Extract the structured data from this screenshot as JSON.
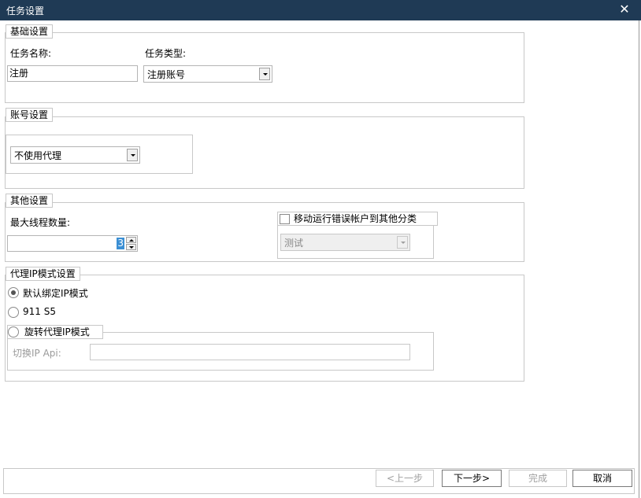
{
  "window": {
    "title": "任务设置",
    "close_glyph": "✕"
  },
  "basic": {
    "legend": "基础设置",
    "name_label": "任务名称:",
    "name_value": "注册",
    "type_label": "任务类型:",
    "type_value": "注册账号"
  },
  "account": {
    "legend": "账号设置",
    "proxy_value": "不使用代理"
  },
  "other": {
    "legend": "其他设置",
    "threads_label": "最大线程数量:",
    "threads_value": "3",
    "move_label": "移动运行错误帐户到其他分类",
    "move_checked": false,
    "category_value": "测试"
  },
  "proxy_ip": {
    "legend": "代理IP模式设置",
    "options": [
      {
        "label": "默认绑定IP模式",
        "checked": true
      },
      {
        "label": "911 S5",
        "checked": false
      },
      {
        "label": "旋转代理IP模式",
        "checked": false
      }
    ],
    "switch_label": "切换IP Api:",
    "switch_value": ""
  },
  "footer": {
    "prev": "<上一步",
    "next": "下一步>",
    "finish": "完成",
    "cancel": "取消"
  }
}
